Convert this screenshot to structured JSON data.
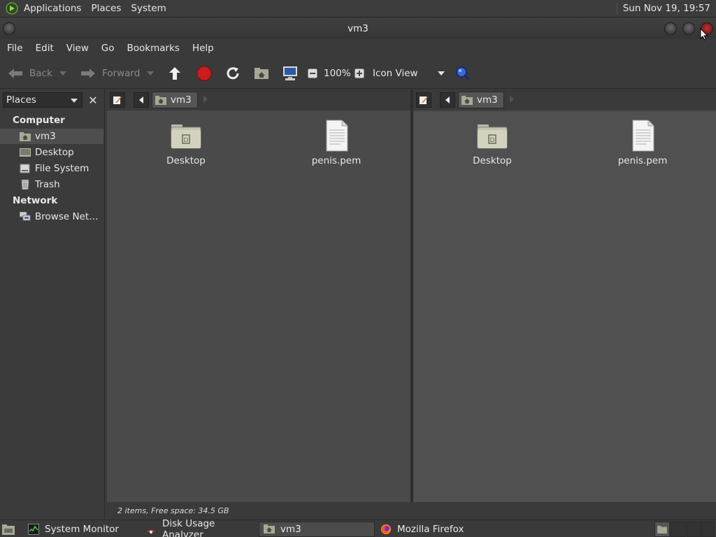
{
  "top_panel": {
    "menus": [
      "Applications",
      "Places",
      "System"
    ],
    "clock": "Sun Nov 19, 19:57"
  },
  "window": {
    "title": "vm3"
  },
  "menubar": {
    "items": [
      "File",
      "Edit",
      "View",
      "Go",
      "Bookmarks",
      "Help"
    ]
  },
  "toolbar": {
    "back_label": "Back",
    "forward_label": "Forward",
    "zoom_level": "100%",
    "view_mode": "Icon View"
  },
  "sidebar": {
    "selector_label": "Places",
    "sections": [
      {
        "heading": "Computer",
        "items": [
          {
            "label": "vm3",
            "icon": "home-folder-icon"
          },
          {
            "label": "Desktop",
            "icon": "desktop-icon"
          },
          {
            "label": "File System",
            "icon": "drive-icon"
          },
          {
            "label": "Trash",
            "icon": "trash-icon"
          }
        ]
      },
      {
        "heading": "Network",
        "items": [
          {
            "label": "Browse Net…",
            "icon": "network-icon"
          }
        ]
      }
    ]
  },
  "panes": {
    "left": {
      "location": "vm3",
      "files": [
        {
          "name": "Desktop",
          "icon": "folder-icon"
        },
        {
          "name": "penis.pem",
          "icon": "document-icon"
        }
      ]
    },
    "right": {
      "location": "vm3",
      "files": [
        {
          "name": "Desktop",
          "icon": "folder-icon"
        },
        {
          "name": "penis.pem",
          "icon": "document-icon"
        }
      ]
    }
  },
  "statusbar": {
    "text": "2 items, Free space: 34.5 GB"
  },
  "taskbar": {
    "tasks": [
      {
        "label": "System Monitor",
        "icon": "system-monitor-icon",
        "active": false
      },
      {
        "label": "Disk Usage Analyzer",
        "icon": "disk-usage-icon",
        "active": false
      },
      {
        "label": "vm3",
        "icon": "home-folder-icon",
        "active": true
      },
      {
        "label": "Mozilla Firefox",
        "icon": "firefox-icon",
        "active": false
      }
    ]
  },
  "colors": {
    "panel_bg": "#3a3a3a",
    "pane_bg": "#4a4a4a",
    "stop_red": "#c81e1e",
    "close_red": "#c03030"
  }
}
